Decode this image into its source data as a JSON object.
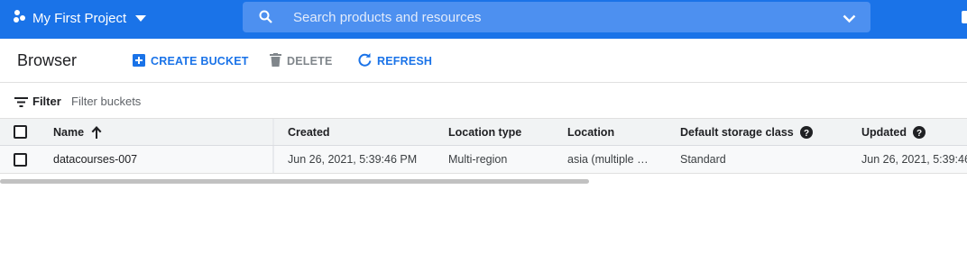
{
  "topbar": {
    "project_name": "My First Project",
    "search_placeholder": "Search products and resources",
    "brand_color": "#1a73e8"
  },
  "toolbar": {
    "title": "Browser",
    "create_label": "CREATE BUCKET",
    "delete_label": "DELETE",
    "refresh_label": "REFRESH"
  },
  "filter": {
    "label": "Filter",
    "placeholder": "Filter buckets"
  },
  "table": {
    "columns": {
      "name": "Name",
      "created": "Created",
      "location_type": "Location type",
      "location": "Location",
      "storage_class": "Default storage class",
      "updated": "Updated"
    },
    "rows": [
      {
        "name": "datacourses-007",
        "created": "Jun 26, 2021, 5:39:46 PM",
        "location_type": "Multi-region",
        "location": "asia (multiple …",
        "storage_class": "Standard",
        "updated": "Jun 26, 2021, 5:39:46"
      }
    ]
  },
  "icons": {
    "project": "project-dots-icon",
    "dropdown": "caret-down-icon",
    "search": "search-icon",
    "expand": "chevron-down-icon",
    "add": "add-box-icon",
    "delete": "trash-icon",
    "refresh": "refresh-icon",
    "filter": "filter-list-icon",
    "sort": "arrow-up-icon",
    "help": "help-circle-icon"
  }
}
